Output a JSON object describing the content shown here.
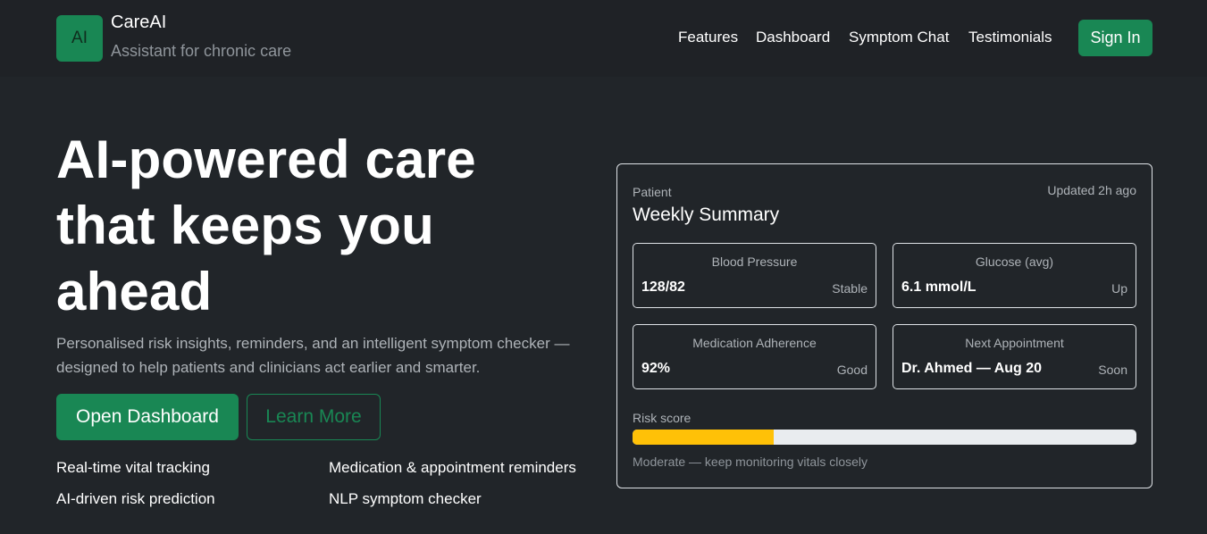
{
  "brand": {
    "logo_text": "AI",
    "name": "CareAI",
    "tagline": "Assistant for chronic care"
  },
  "nav": {
    "links": [
      "Features",
      "Dashboard",
      "Symptom Chat",
      "Testimonials"
    ],
    "signin_label": "Sign In"
  },
  "hero": {
    "title_lines": [
      "AI-powered care",
      "that keeps you",
      "ahead"
    ],
    "subtitle": "Personalised risk insights, reminders, and an intelligent symptom checker — designed to help patients and clinicians act earlier and smarter.",
    "primary_cta": "Open Dashboard",
    "secondary_cta": "Learn More",
    "features": [
      "Real-time vital tracking",
      "Medication & appointment reminders",
      "AI-driven risk prediction",
      "NLP symptom checker"
    ]
  },
  "summary_card": {
    "eyebrow": "Patient",
    "title": "Weekly Summary",
    "updated": "Updated 2h ago",
    "metrics": [
      {
        "label": "Blood Pressure",
        "value": "128/82",
        "status": "Stable"
      },
      {
        "label": "Glucose (avg)",
        "value": "6.1 mmol/L",
        "status": "Up"
      },
      {
        "label": "Medication Adherence",
        "value": "92%",
        "status": "Good"
      },
      {
        "label": "Next Appointment",
        "value": "Dr. Ahmed — Aug 20",
        "status": "Soon"
      }
    ],
    "risk": {
      "label": "Risk score",
      "level_fraction": 0.28,
      "note": "Moderate — keep monitoring vitals closely"
    }
  },
  "colors": {
    "background": "#212529",
    "accent": "#198754",
    "risk_bar": "#ffc107",
    "risk_track": "#e9ecef"
  }
}
